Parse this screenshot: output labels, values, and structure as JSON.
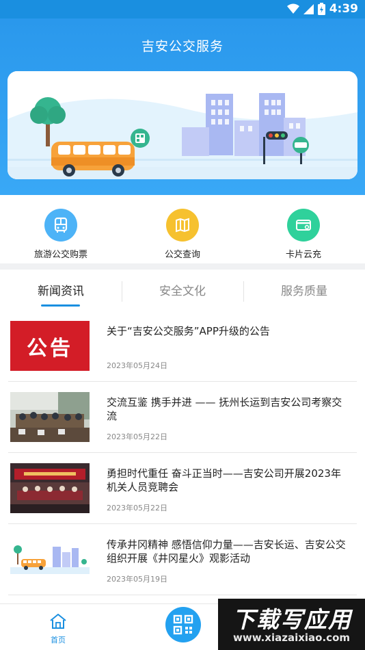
{
  "status_bar": {
    "time": "4:39"
  },
  "header": {
    "title": "吉安公交服务"
  },
  "quick_menu": [
    {
      "label": "旅游公交购票",
      "icon": "bus-icon",
      "color": "#4db3f7"
    },
    {
      "label": "公交查询",
      "icon": "map-book-icon",
      "color": "#f6c12f"
    },
    {
      "label": "卡片云充",
      "icon": "card-icon",
      "color": "#2fd19b"
    }
  ],
  "tabs": [
    {
      "label": "新闻资讯",
      "active": true
    },
    {
      "label": "安全文化",
      "active": false
    },
    {
      "label": "服务质量",
      "active": false
    }
  ],
  "news": [
    {
      "title": "关于“吉安公交服务”APP升级的公告",
      "date": "2023年05月24日",
      "thumb_text": "公告"
    },
    {
      "title": "交流互鉴 携手并进 —— 抚州长运到吉安公司考察交流",
      "date": "2023年05月22日"
    },
    {
      "title": "勇担时代重任 奋斗正当时——吉安公司开展2023年机关人员竞聘会",
      "date": "2023年05月22日"
    },
    {
      "title": "传承井冈精神 感悟信仰力量——吉安长运、吉安公交组织开展《井冈星火》观影活动",
      "date": "2023年05月19日"
    }
  ],
  "bottom_nav": {
    "home_label": "首页"
  },
  "watermark": {
    "main": "下载写应用",
    "sub": "www.xiazaixiao.com"
  },
  "colors": {
    "primary": "#1a8fe0",
    "header_bg": "#2a98ec",
    "notice_red": "#d31d27"
  }
}
